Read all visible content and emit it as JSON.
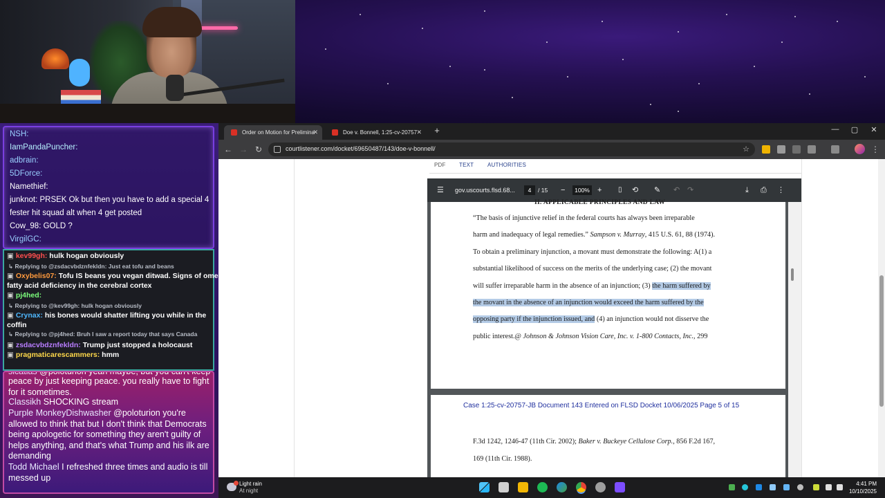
{
  "chat_top": [
    {
      "user": "NSH:",
      "msg": "",
      "color": "#9ad0ff"
    },
    {
      "user": "IamPandaPuncher:",
      "msg": "",
      "color": "#b6f0ff"
    },
    {
      "user": "adbrain:",
      "msg": "",
      "color": "#9ad0ff"
    },
    {
      "user": "5DForce:",
      "msg": "",
      "color": "#9ad0ff"
    },
    {
      "user": "Namethief:",
      "msg": "",
      "color": "#ffffff"
    },
    {
      "user": "junknot:",
      "msg": "PRSEK Ok but then you have to add a special 4",
      "color": "#ffffff"
    },
    {
      "user": "",
      "msg": "fester hit squad alt when 4  get posted",
      "color": "#ffffff"
    },
    {
      "user": "Cow_98:",
      "msg": "GOLD  ?",
      "color": "#ffffff"
    },
    {
      "user": "VirgilGC:",
      "msg": "",
      "color": "#9ad0ff"
    }
  ],
  "chat_mid": [
    {
      "type": "msg",
      "user": "kev99gh:",
      "msg": "hulk hogan obviously",
      "color": "#ff4f4f"
    },
    {
      "type": "reply",
      "text": "Replying to @zsdacvbdznfekldn: Just eat tofu and beans"
    },
    {
      "type": "msg",
      "user": "Oxybelis07:",
      "msg": "Tofu IS beans you vegan ditwad. Signs of omega",
      "color": "#ff9a3d"
    },
    {
      "type": "cont",
      "msg": "fatty acid deficiency in the cerebral cortex"
    },
    {
      "type": "msg",
      "user": "pj4hed:",
      "msg": "",
      "color": "#7cff7c"
    },
    {
      "type": "reply",
      "text": "Replying to @kev99gh: hulk hogan obviously"
    },
    {
      "type": "msg",
      "user": "Crynax:",
      "msg": "his bones would shatter lifting you while in the",
      "color": "#4fb8ff"
    },
    {
      "type": "cont",
      "msg": "coffin"
    },
    {
      "type": "reply",
      "text": "Replying to @pj4hed:   Bruh I saw a report today that says Canada"
    },
    {
      "type": "msg",
      "user": "zsdacvbdznfekldn:",
      "msg": "Trump just stopped a holocaust",
      "color": "#b87dff"
    },
    {
      "type": "msg",
      "user": "pragmaticarescammers:",
      "msg": "hmm",
      "color": "#ffd84a"
    }
  ],
  "chat_bottom": [
    {
      "user": "",
      "msg": "peace by just keeping peace. you really have to fight for it sometimes."
    },
    {
      "user": "Classikh",
      "msg": "SHOCKING stream"
    },
    {
      "user": "Purple MonkeyDishwasher",
      "msg": "@poloturion you're allowed to think that but I don't think that Democrats being apologetic for something they aren't guilty of helps anything, and that's what Trump and his ilk are demanding"
    },
    {
      "user": "Todd Michael",
      "msg": "I refreshed three times and audio is till messed up"
    }
  ],
  "chat_bottom_cut": "@poloturion yeah maybe, but you can't keep",
  "browser": {
    "tabs": [
      {
        "title": "Order on Motion for Prelimina",
        "active": true
      },
      {
        "title": "Doe v. Bonnell, 1:25-cv-20757",
        "active": false
      }
    ],
    "new_tab": "+",
    "url": "courtlistener.com/docket/69650487/143/doe-v-bonnell/",
    "nav": {
      "back": "←",
      "forward": "→",
      "reload": "↻"
    },
    "win": {
      "min": "—",
      "max": "▢",
      "close": "✕"
    },
    "star": "☆"
  },
  "page_tabs": [
    "PDF",
    "TEXT",
    "AUTHORITIES"
  ],
  "pdf": {
    "title": "gov.uscourts.flsd.68...",
    "page": "4",
    "total": "/ 15",
    "zoom": "100%",
    "heading": "II.  APPLICABLE PRINCIPLES AND LAW",
    "lines": [
      {
        "segs": [
          {
            "t": "       “The basis of injunctive relief in the federal courts has always been irreparable"
          }
        ]
      },
      {
        "segs": [
          {
            "t": "harm and inadequacy of legal remedies.”  "
          },
          {
            "t": "Sampson v. Murray",
            "i": true
          },
          {
            "t": ", 415 U.S. 61, 88 (1974)."
          }
        ]
      },
      {
        "segs": [
          {
            "t": "To obtain a preliminary injunction, a movant must demonstrate the following: A(1) a"
          }
        ]
      },
      {
        "segs": [
          {
            "t": "substantial likelihood of success on the merits of the underlying case; (2) the movant"
          }
        ]
      },
      {
        "segs": [
          {
            "t": "will suffer irreparable harm in the absence of an injunction; (3) "
          },
          {
            "t": "the harm suffered by",
            "h": true
          }
        ]
      },
      {
        "segs": [
          {
            "t": "the movant in the absence of an injunction would exceed the harm suffered by the",
            "h": true
          }
        ]
      },
      {
        "segs": [
          {
            "t": "opposing party if the injunction issued, and",
            "h": true
          },
          {
            "t": " (4) an injunction would not disserve the"
          }
        ]
      },
      {
        "segs": [
          {
            "t": "public interest.@  "
          },
          {
            "t": "Johnson & Johnson Vision Care, Inc. v. 1-800 Contacts, Inc.",
            "i": true
          },
          {
            "t": ", 299"
          }
        ]
      }
    ],
    "stamp": "Case 1:25-cv-20757-JB   Document 143   Entered on FLSD Docket 10/06/2025   Page 5 of 15",
    "lines2": [
      {
        "segs": [
          {
            "t": "F.3d 1242, 1246-47 (11th Cir. 2002); "
          },
          {
            "t": "Baker v. Buckeye Cellulose Corp.",
            "i": true
          },
          {
            "t": ", 856 F.2d 167,"
          }
        ]
      },
      {
        "segs": [
          {
            "t": "169 (11th Cir. 1988)."
          }
        ]
      }
    ]
  },
  "taskbar": {
    "weather_title": "Light rain",
    "weather_sub": "At night",
    "time": "4:41 PM",
    "date": "10/10/2025"
  }
}
